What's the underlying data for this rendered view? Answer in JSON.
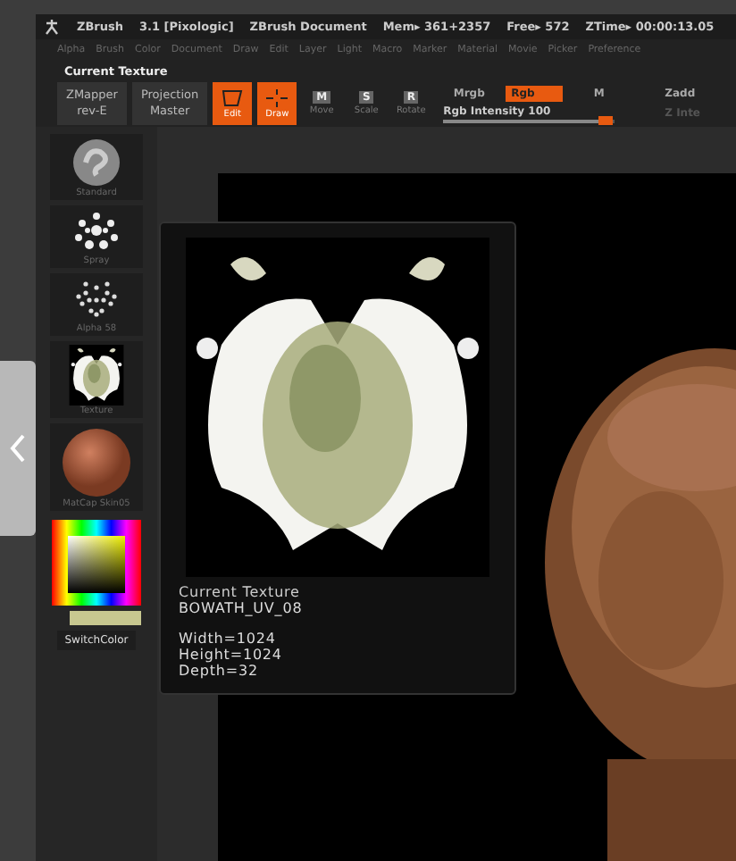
{
  "title_bar": {
    "app": "ZBrush",
    "version": "3.1 [Pixologic]",
    "document": "ZBrush Document",
    "mem": "Mem▸ 361+2357",
    "free": "Free▸ 572",
    "ztime": "ZTime▸ 00:00:13.05"
  },
  "menu": [
    "Alpha",
    "Brush",
    "Color",
    "Document",
    "Draw",
    "Edit",
    "Layer",
    "Light",
    "Macro",
    "Marker",
    "Material",
    "Movie",
    "Picker",
    "Preference"
  ],
  "palette_title": "Current Texture",
  "plugins": [
    {
      "lines": [
        "ZMapper",
        "rev-E"
      ]
    },
    {
      "lines": [
        "Projection",
        "Master"
      ]
    }
  ],
  "modes": [
    {
      "label": "Edit",
      "selected": true
    },
    {
      "label": "Draw",
      "selected": true
    },
    {
      "label": "Move",
      "key": "M",
      "selected": false
    },
    {
      "label": "Scale",
      "key": "S",
      "selected": false
    },
    {
      "label": "Rotate",
      "key": "R",
      "selected": false
    }
  ],
  "color_modes": [
    {
      "label": "Mrgb",
      "selected": false
    },
    {
      "label": "Rgb",
      "selected": true
    },
    {
      "label": "M",
      "selected": false
    }
  ],
  "zadd": "Zadd",
  "rgb_intensity": {
    "label": "Rgb Intensity",
    "value": "100",
    "level": 0.95
  },
  "z_intensity_label": "Z Inte",
  "palette_items": [
    {
      "label": "Standard",
      "kind": "standard"
    },
    {
      "label": "Spray",
      "kind": "spray"
    },
    {
      "label": "Alpha 58",
      "kind": "alpha"
    },
    {
      "label": "Texture",
      "kind": "texture"
    },
    {
      "label": "MatCap Skin05",
      "kind": "material"
    }
  ],
  "switch_color": "SwitchColor",
  "popup": {
    "title": "Current Texture",
    "name": "BOWATH_UV_08",
    "details": [
      "Width=1024",
      "Height=1024",
      "Depth=32"
    ]
  }
}
